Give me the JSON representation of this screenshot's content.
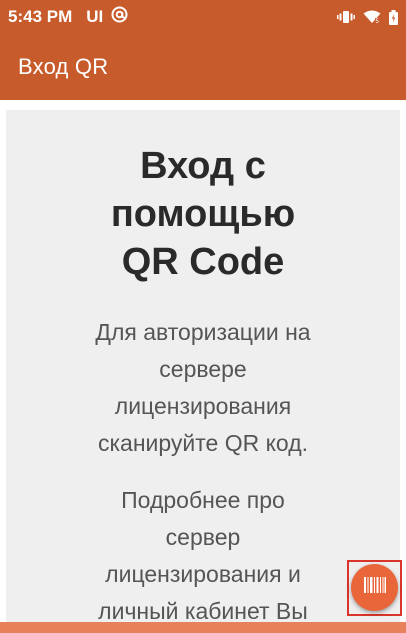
{
  "status_bar": {
    "time": "5:43 PM",
    "ui_label": "UI",
    "icons": [
      "at-sign-icon",
      "vibrate-icon",
      "wifi-icon",
      "battery-icon"
    ]
  },
  "app_bar": {
    "title": "Вход QR"
  },
  "content": {
    "headline_lines": [
      "Вход с",
      "помощью",
      "QR Code"
    ],
    "paragraph1_lines": [
      "Для авторизации на",
      "сервере",
      "лицензирования",
      "сканируйте QR код."
    ],
    "paragraph2_lines": [
      "Подробнее про",
      "сервер",
      "лицензирования и",
      "личный кабинет Вы"
    ]
  },
  "fab": {
    "icon": "barcode-icon"
  },
  "colors": {
    "primary": "#c75b2c",
    "accent": "#e8663a",
    "card_background": "#efefef",
    "highlight_border": "#d9352a"
  }
}
